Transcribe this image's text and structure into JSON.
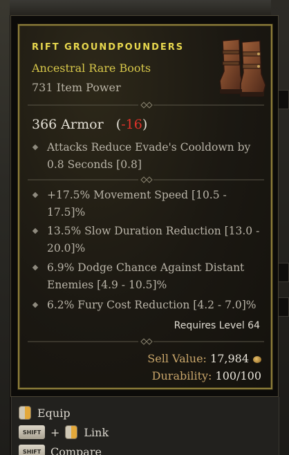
{
  "item": {
    "name": "Rift Groundpounders",
    "type": "Ancestral Rare Boots",
    "power": "731 Item Power",
    "armor_value": "366 Armor",
    "armor_delta": "-16",
    "implicit": "Attacks Reduce Evade's Cooldown by 0.8 Seconds [0.8]",
    "affixes": [
      "+17.5% Movement Speed [10.5 - 17.5]%",
      "13.5% Slow Duration Reduction [13.0 - 20.0]%",
      "6.9% Dodge Chance Against Distant Enemies [4.9 - 10.5]%",
      "6.2% Fury Cost Reduction [4.2 - 7.0]%"
    ],
    "requirement": "Requires Level 64",
    "sell_label": "Sell Value:",
    "sell_value": "17,984",
    "durability_label": "Durability:",
    "durability_value": "100/100"
  },
  "controls": {
    "equip": "Equip",
    "shift": "SHIFT",
    "plus": "+",
    "link": "Link",
    "compare": "Compare"
  },
  "colors": {
    "title": "#e8d84e",
    "rare": "#d8c84a",
    "negative": "#e0322a",
    "gold": "#c9a66a"
  }
}
